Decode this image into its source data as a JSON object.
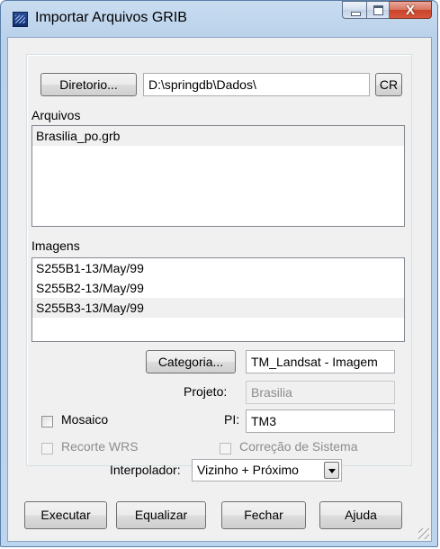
{
  "window": {
    "title": "Importar Arquivos GRIB",
    "close_glyph": "X",
    "app_icon": "grib-app-icon"
  },
  "directory": {
    "button_label": "Diretorio...",
    "path_value": "D:\\springdb\\Dados\\",
    "cr_label": "CR"
  },
  "files": {
    "label": "Arquivos",
    "items": [
      "Brasilia_po.grb"
    ]
  },
  "images": {
    "label": "Imagens",
    "items": [
      "S255B1-13/May/99",
      "S255B2-13/May/99",
      "S255B3-13/May/99"
    ]
  },
  "category": {
    "button_label": "Categoria...",
    "value": "TM_Landsat - Imagem"
  },
  "project": {
    "label": "Projeto:",
    "value": "Brasilia"
  },
  "mosaic": {
    "label": "Mosaico",
    "checked": false
  },
  "pi": {
    "label": "PI:",
    "value": "TM3"
  },
  "wrs_cut": {
    "label": "Recorte WRS",
    "checked": false
  },
  "system_correction": {
    "label": "Correção de Sistema",
    "checked": false
  },
  "interpolator": {
    "label": "Interpolador:",
    "selected": "Vizinho + Próximo"
  },
  "actions": {
    "execute_label": "Executar",
    "equalize_label": "Equalizar",
    "close_label": "Fechar",
    "help_label": "Ajuda"
  }
}
